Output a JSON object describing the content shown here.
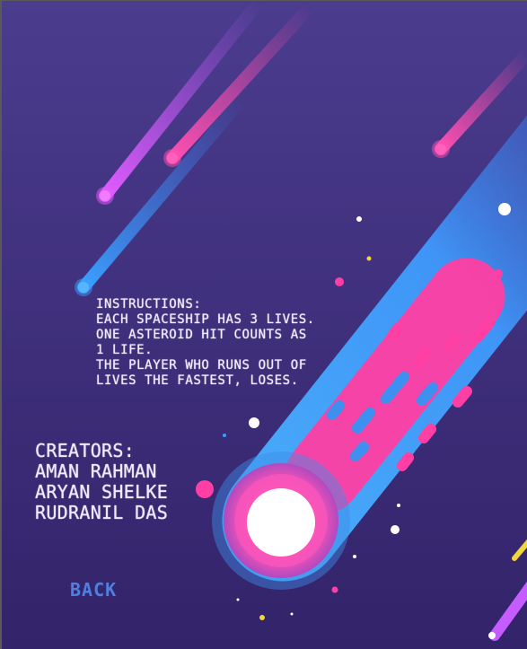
{
  "instructions": {
    "lines": [
      "INSTRUCTIONS:",
      "EACH SPACESHIP HAS 3 LIVES.",
      "ONE ASTEROID HIT COUNTS AS",
      "1 LIFE.",
      "THE PLAYER WHO RUNS OUT OF",
      "LIVES THE FASTEST, LOSES."
    ]
  },
  "creators": {
    "heading": "CREATORS:",
    "names": [
      "AMAN RAHMAN",
      "ARYAN SHELKE",
      "RUDRANIL DAS"
    ]
  },
  "back_button": {
    "label": "BACK"
  },
  "colors": {
    "background": "#3c2d7a",
    "comet_blue": "#4aa3f5",
    "comet_pink": "#ff3fa4",
    "text": "#f1ecff",
    "back_button": "#4f7fe0"
  }
}
